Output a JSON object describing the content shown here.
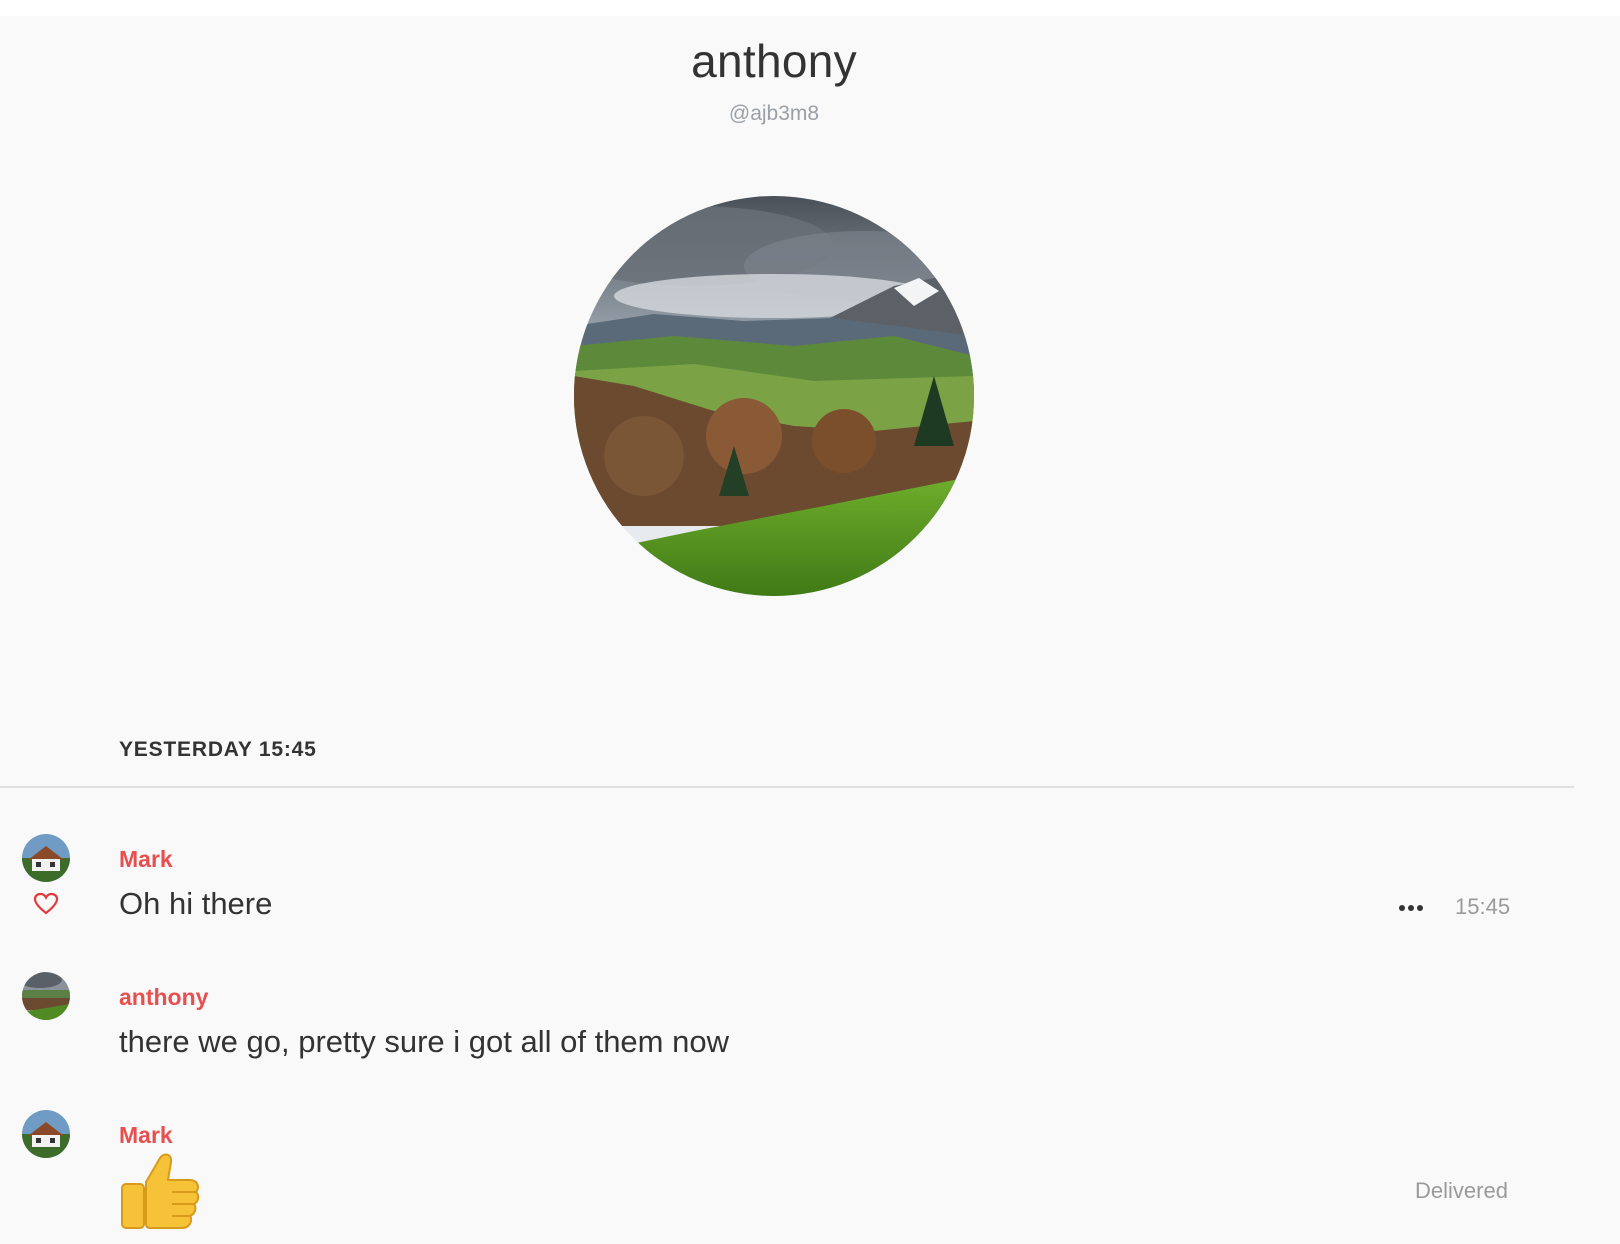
{
  "profile": {
    "name": "anthony",
    "handle": "@ajb3m8"
  },
  "conversation": {
    "day_header": "YESTERDAY 15:45",
    "messages": [
      {
        "author": "Mark",
        "text": "Oh hi there",
        "time": "15:45",
        "reaction": "heart-icon"
      },
      {
        "author": "anthony",
        "text": "there we go, pretty sure i got all of them now"
      },
      {
        "author": "Mark",
        "emoji": "thumbs-up-emoji",
        "status": "Delivered"
      }
    ]
  },
  "colors": {
    "author": "#e85050",
    "background": "#f9f9f9",
    "text": "#333333",
    "muted": "#9a9a9a"
  }
}
